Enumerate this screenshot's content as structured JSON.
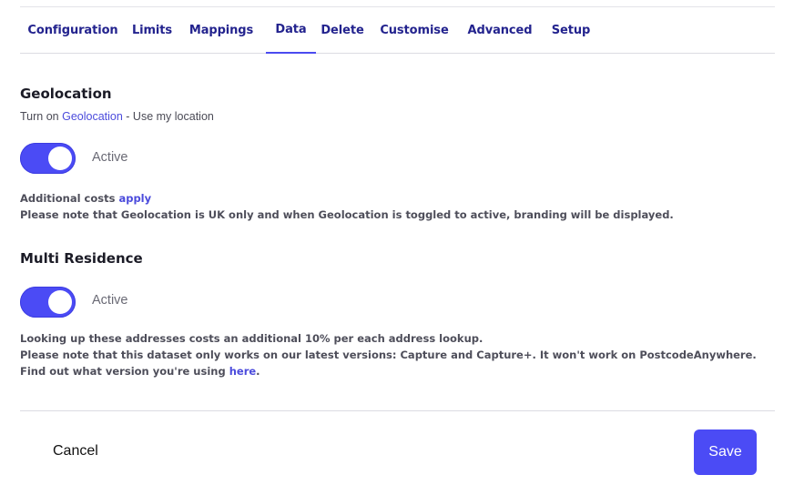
{
  "tabs": [
    {
      "label": "Configuration"
    },
    {
      "label": "Limits"
    },
    {
      "label": "Mappings"
    },
    {
      "label": "Data",
      "active": true
    },
    {
      "label": "Delete"
    },
    {
      "label": "Customise"
    },
    {
      "label": "Advanced"
    },
    {
      "label": "Setup"
    }
  ],
  "geolocation": {
    "title": "Geolocation",
    "subtitle_prefix": "Turn on ",
    "subtitle_link": "Geolocation",
    "subtitle_suffix": " - Use my location",
    "toggle_state": "Active",
    "enabled": true,
    "costs_prefix": "Additional costs ",
    "costs_link": "apply",
    "note": "Please note that Geolocation is UK only and when Geolocation is toggled to active, branding will be displayed."
  },
  "multi_residence": {
    "title": "Multi Residence",
    "toggle_state": "Active",
    "enabled": true,
    "note_line1": "Looking up these addresses costs an additional 10% per each address lookup.",
    "note_line2": "Please note that this dataset only works on our latest versions: Capture and Capture+. It won't work on PostcodeAnywhere. Find out what version you're using ",
    "note_link": "here",
    "note_end": "."
  },
  "footer": {
    "cancel_label": "Cancel",
    "save_label": "Save"
  },
  "colors": {
    "accent": "#4b4bf5",
    "tab_text": "#23238e",
    "link": "#4b4bdc"
  }
}
